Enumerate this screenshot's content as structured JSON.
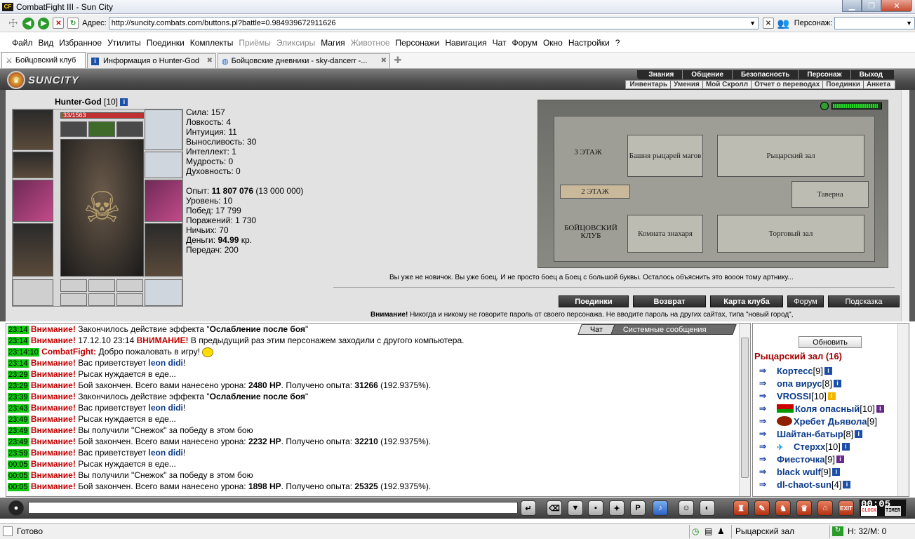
{
  "window": {
    "title": "CombatFight III - Sun City",
    "logo": "CF"
  },
  "addressbar": {
    "label": "Адрес:",
    "url": "http://suncity.combats.com/buttons.pl?battle=0.984939672911626",
    "person_label": "Персонаж:"
  },
  "menu": {
    "items": [
      {
        "label": "Файл",
        "enabled": true
      },
      {
        "label": "Вид",
        "enabled": true
      },
      {
        "label": "Избранное",
        "enabled": true
      },
      {
        "label": "Утилиты",
        "enabled": true
      },
      {
        "label": "Поединки",
        "enabled": true
      },
      {
        "label": "Комплекты",
        "enabled": true
      },
      {
        "label": "Приёмы",
        "enabled": false
      },
      {
        "label": "Эликсиры",
        "enabled": false
      },
      {
        "label": "Магия",
        "enabled": true
      },
      {
        "label": "Животное",
        "enabled": false
      },
      {
        "label": "Персонажи",
        "enabled": true
      },
      {
        "label": "Навигация",
        "enabled": true
      },
      {
        "label": "Чат",
        "enabled": true
      },
      {
        "label": "Форум",
        "enabled": true
      },
      {
        "label": "Окно",
        "enabled": true
      },
      {
        "label": "Настройки",
        "enabled": true
      },
      {
        "label": "?",
        "enabled": true
      }
    ]
  },
  "tabs": [
    {
      "label": "Бойцовский клуб",
      "active": true
    },
    {
      "label": "Информация о Hunter-God",
      "active": false
    },
    {
      "label": "Бойцовские дневники - sky-dancerr -...",
      "active": false
    }
  ],
  "header": {
    "logo_text": "SUNCITY",
    "nav_top": [
      "Знания",
      "Общение",
      "Безопасность",
      "Персонаж",
      "Выход"
    ],
    "nav_bottom": [
      "Инвентарь",
      "Умения",
      "Мой Скролл",
      "Отчет о переводах",
      "Поединки",
      "Анкета"
    ]
  },
  "character": {
    "name": "Hunter-God",
    "level": "[10]",
    "hp": "33/1563",
    "hp_fraction": 0.021,
    "stats": [
      {
        "label": "Сила: ",
        "value": "157"
      },
      {
        "label": "Ловкость: ",
        "value": "4"
      },
      {
        "label": "Интуиция: ",
        "value": "11"
      },
      {
        "label": "Выносливость: ",
        "value": "30"
      },
      {
        "label": "Интеллект: ",
        "value": "1"
      },
      {
        "label": "Мудрость: ",
        "value": "0"
      },
      {
        "label": "Духовность: ",
        "value": "0"
      }
    ],
    "exp_label": "Опыт: ",
    "exp_value": "11 807 076",
    "exp_next": " (13 000 000)",
    "level_label": "Уровень: ",
    "level_value": "10",
    "wins_label": "Побед: ",
    "wins_value": "17 799",
    "losses_label": "Поражений: ",
    "losses_value": "1 730",
    "draws_label": "Ничьих: ",
    "draws_value": "70",
    "money_label": "Деньги: ",
    "money_value": "94.99",
    "money_unit": " кр.",
    "transfers_label": "Передач: ",
    "transfers_value": "200"
  },
  "map": {
    "rooms": {
      "floor3": "3 ЭТАЖ",
      "knights_tower": "Башня рыцарей магов",
      "knights_hall": "Рыцарский зал",
      "floor2": "2 ЭТАЖ",
      "tavern": "Таверна",
      "fight_club": "БОЙЦОВСКИЙ КЛУБ",
      "healer_room": "Комната знахаря",
      "trade_hall": "Торговый зал"
    },
    "meter_fraction": 0.92
  },
  "novice_text": "Вы уже не новичок. Вы уже боец. И не просто боец а Боец с большой буквы. Осталось объяснить это вооон тому артнику...",
  "actions": [
    "Поединки",
    "Возврат",
    "Карта клуба",
    "Форум",
    "Подсказка"
  ],
  "warning": {
    "bold": "Внимание!",
    "text": " Никогда и никому не говорите пароль от своего персонажа. Не вводите пароль на других сайтах, типа \"новый город\","
  },
  "chat": {
    "tabs": [
      "Чат",
      "Системные сообщения"
    ],
    "messages": [
      {
        "time": "23:14",
        "parts": [
          [
            "warn",
            "Внимание!"
          ],
          [
            "t",
            " Закончилось действие эффекта \""
          ],
          [
            "b",
            "Ослабление после боя"
          ],
          [
            "t",
            "\""
          ]
        ]
      },
      {
        "time": "23:14",
        "parts": [
          [
            "warn",
            "Внимание!"
          ],
          [
            "t",
            " 17.12.10 23:14 "
          ],
          [
            "warn",
            "ВНИМАНИЕ!"
          ],
          [
            "t",
            " В предыдущий раз этим персонажем заходили с другого компьютера."
          ]
        ]
      },
      {
        "time": "23:14:10",
        "parts": [
          [
            "cf",
            "CombatFight:"
          ],
          [
            "t",
            " Добро пожаловать в игру! "
          ],
          [
            "smile",
            ""
          ]
        ]
      },
      {
        "time": "23:14",
        "parts": [
          [
            "warn",
            "Внимание!"
          ],
          [
            "t",
            " Вас приветствует "
          ],
          [
            "nick",
            "leon didi"
          ],
          [
            "t",
            "!"
          ]
        ]
      },
      {
        "time": "23:29",
        "parts": [
          [
            "warn",
            "Внимание!"
          ],
          [
            "t",
            " Рысак нуждается в еде..."
          ]
        ]
      },
      {
        "time": "23:29",
        "parts": [
          [
            "warn",
            "Внимание!"
          ],
          [
            "t",
            " Бой закончен. Всего вами нанесено урона: "
          ],
          [
            "b",
            "2480 HP"
          ],
          [
            "t",
            ". Получено опыта: "
          ],
          [
            "b",
            "31266"
          ],
          [
            "t",
            " (192.9375%)."
          ]
        ]
      },
      {
        "time": "23:39",
        "parts": [
          [
            "warn",
            "Внимание!"
          ],
          [
            "t",
            " Закончилось действие эффекта \""
          ],
          [
            "b",
            "Ослабление после боя"
          ],
          [
            "t",
            "\""
          ]
        ]
      },
      {
        "time": "23:43",
        "parts": [
          [
            "warn",
            "Внимание!"
          ],
          [
            "t",
            " Вас приветствует "
          ],
          [
            "nick",
            "leon didi"
          ],
          [
            "t",
            "!"
          ]
        ]
      },
      {
        "time": "23:49",
        "parts": [
          [
            "warn",
            "Внимание!"
          ],
          [
            "t",
            " Рысак нуждается в еде..."
          ]
        ]
      },
      {
        "time": "23:49",
        "parts": [
          [
            "warn",
            "Внимание!"
          ],
          [
            "t",
            " Вы получили \"Снежок\" за победу в этом бою"
          ]
        ]
      },
      {
        "time": "23:49",
        "parts": [
          [
            "warn",
            "Внимание!"
          ],
          [
            "t",
            " Бой закончен. Всего вами нанесено урона: "
          ],
          [
            "b",
            "2232 HP"
          ],
          [
            "t",
            ". Получено опыта: "
          ],
          [
            "b",
            "32210"
          ],
          [
            "t",
            " (192.9375%)."
          ]
        ]
      },
      {
        "time": "23:59",
        "parts": [
          [
            "warn",
            "Внимание!"
          ],
          [
            "t",
            " Вас приветствует "
          ],
          [
            "nick",
            "leon didi"
          ],
          [
            "t",
            "!"
          ]
        ]
      },
      {
        "time": "00:05",
        "parts": [
          [
            "warn",
            "Внимание!"
          ],
          [
            "t",
            " Рысак нуждается в еде..."
          ]
        ]
      },
      {
        "time": "00:05",
        "parts": [
          [
            "warn",
            "Внимание!"
          ],
          [
            "t",
            " Вы получили \"Снежок\" за победу в этом бою"
          ]
        ]
      },
      {
        "time": "00:05",
        "parts": [
          [
            "warn",
            "Внимание!"
          ],
          [
            "t",
            " Бой закончен. Всего вами нанесено урона: "
          ],
          [
            "b",
            "1898 HP"
          ],
          [
            "t",
            ". Получено опыта: "
          ],
          [
            "b",
            "25325"
          ],
          [
            "t",
            " (192.9375%)."
          ]
        ]
      }
    ]
  },
  "who": {
    "refresh": "Обновить",
    "room": "Рыцарский зал (16)",
    "users": [
      {
        "name": "Кортесс",
        "level": "[9]",
        "badge": "b",
        "mark": ""
      },
      {
        "name": "опа вирус",
        "level": "[8]",
        "badge": "b",
        "mark": ""
      },
      {
        "name": "VROSSI",
        "level": "[10]",
        "badge": "y",
        "mark": ""
      },
      {
        "name": "Коля опасный",
        "level": "[10]",
        "badge": "p",
        "mark": "flag"
      },
      {
        "name": "Хребет Дьявола",
        "level": "[9]",
        "badge": "",
        "mark": "clan"
      },
      {
        "name": "Шайтан-батыр",
        "level": "[8]",
        "badge": "b",
        "mark": ""
      },
      {
        "name": "Стерхх",
        "level": "[10]",
        "badge": "b",
        "mark": "wing"
      },
      {
        "name": "Фиесточка",
        "level": "[9]",
        "badge": "p",
        "mark": ""
      },
      {
        "name": "black wulf",
        "level": "[9]",
        "badge": "b",
        "mark": ""
      },
      {
        "name": "dl-chaot-sun",
        "level": "[4]",
        "badge": "b",
        "mark": ""
      }
    ]
  },
  "clock": {
    "time": "00:05",
    "label_clock": "CLOCK",
    "label_timer": "TIMER",
    "badge": "EXIT"
  },
  "statusbar": {
    "left": "Готово",
    "room": "Рыцарский зал",
    "hm": "H: 32/M: 0"
  }
}
